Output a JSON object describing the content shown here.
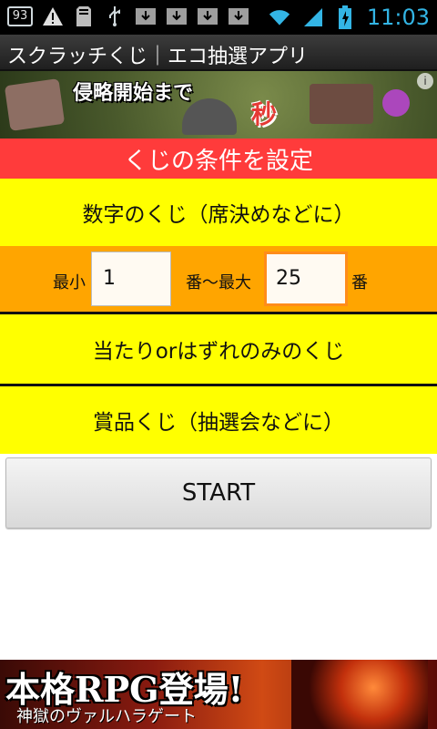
{
  "status_bar": {
    "notification_count": "93",
    "time": "11:03",
    "accent_color": "#33b5e5"
  },
  "app": {
    "title": "スクラッチくじ｜エコ抽選アプリ"
  },
  "ad_top": {
    "text": "侵略開始まで",
    "text2": "秒",
    "info": "i"
  },
  "header": {
    "title": "くじの条件を設定"
  },
  "options": {
    "numeric": "数字のくじ（席決めなどに）",
    "min_label": "最小",
    "min_value": "1",
    "mid_label": "番～最大",
    "max_value": "25",
    "end_label": "番",
    "win_lose": "当たりorはずれのみのくじ",
    "prize": "賞品くじ（抽選会などに）"
  },
  "start_button": {
    "label": "START"
  },
  "ad_bottom": {
    "headline": "本格RPG登場!",
    "subline": "神獄のヴァルハラゲート"
  },
  "colors": {
    "header_red": "#ff3b3b",
    "option_yellow": "#ffff00",
    "range_orange": "#ffa500",
    "focus_orange": "#ff8c1a"
  }
}
